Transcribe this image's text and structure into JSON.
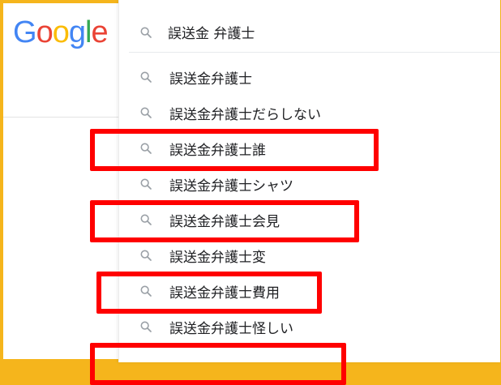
{
  "logo": {
    "letters": [
      "G",
      "o",
      "o",
      "g",
      "l",
      "e"
    ],
    "colors": [
      "#4285f4",
      "#ea4335",
      "#fbbc05",
      "#4285f4",
      "#34a853",
      "#ea4335"
    ]
  },
  "search": {
    "query": "誤送金 弁護士"
  },
  "suggestions": [
    {
      "text": "誤送金弁護士",
      "highlighted": false
    },
    {
      "text": "誤送金弁護士だらしない",
      "highlighted": true
    },
    {
      "text": "誤送金弁護士誰",
      "highlighted": false
    },
    {
      "text": "誤送金弁護士シャツ",
      "highlighted": true
    },
    {
      "text": "誤送金弁護士会見",
      "highlighted": false
    },
    {
      "text": "誤送金弁護士変",
      "highlighted": true
    },
    {
      "text": "誤送金弁護士費用",
      "highlighted": false
    },
    {
      "text": "誤送金弁護士怪しい",
      "highlighted": true
    }
  ],
  "colors": {
    "frame": "#f5b51c",
    "highlight_box": "#ff0000",
    "icon": "#9aa0a6",
    "text": "#202124"
  }
}
